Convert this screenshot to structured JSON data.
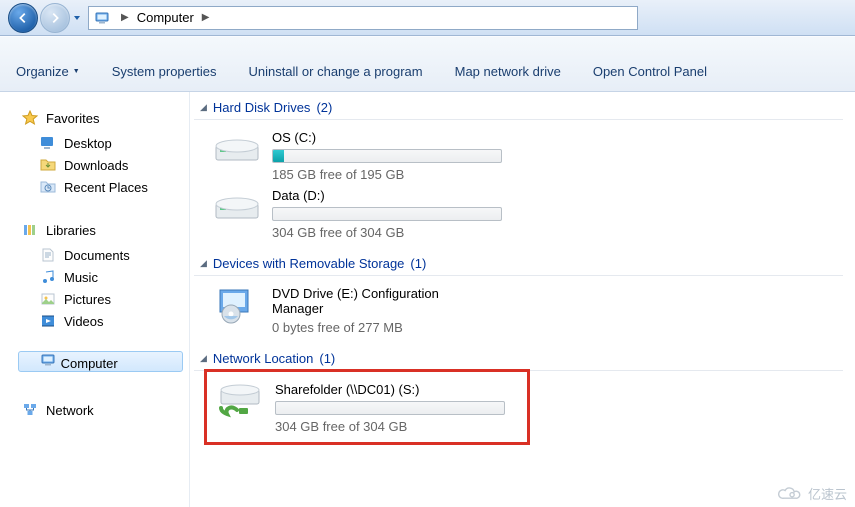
{
  "breadcrumb": {
    "segments": [
      "Computer"
    ]
  },
  "toolbar": {
    "organize": "Organize",
    "sysprops": "System properties",
    "uninstall": "Uninstall or change a program",
    "mapdrive": "Map network drive",
    "ctrlpanel": "Open Control Panel"
  },
  "sidebar": {
    "favorites": {
      "label": "Favorites",
      "items": [
        {
          "label": "Desktop",
          "data_name": "nav-desktop"
        },
        {
          "label": "Downloads",
          "data_name": "nav-downloads"
        },
        {
          "label": "Recent Places",
          "data_name": "nav-recent-places"
        }
      ]
    },
    "libraries": {
      "label": "Libraries",
      "items": [
        {
          "label": "Documents",
          "data_name": "nav-documents"
        },
        {
          "label": "Music",
          "data_name": "nav-music"
        },
        {
          "label": "Pictures",
          "data_name": "nav-pictures"
        },
        {
          "label": "Videos",
          "data_name": "nav-videos"
        }
      ]
    },
    "computer": {
      "label": "Computer"
    },
    "network": {
      "label": "Network"
    }
  },
  "sections": {
    "hdd": {
      "title": "Hard Disk Drives",
      "count": "(2)"
    },
    "remv": {
      "title": "Devices with Removable Storage",
      "count": "(1)"
    },
    "net": {
      "title": "Network Location",
      "count": "(1)"
    }
  },
  "drives": {
    "c": {
      "name": "OS (C:)",
      "free": "185 GB free of 195 GB",
      "pct": 5
    },
    "d": {
      "name": "Data (D:)",
      "free": "304 GB free of 304 GB",
      "pct": 0
    },
    "e": {
      "name": "DVD Drive (E:) Configuration Manager",
      "free": "0 bytes free of 277 MB"
    },
    "s": {
      "name": "Sharefolder (\\\\DC01) (S:)",
      "free": "304 GB free of 304 GB",
      "pct": 0
    }
  },
  "watermark": "亿速云"
}
